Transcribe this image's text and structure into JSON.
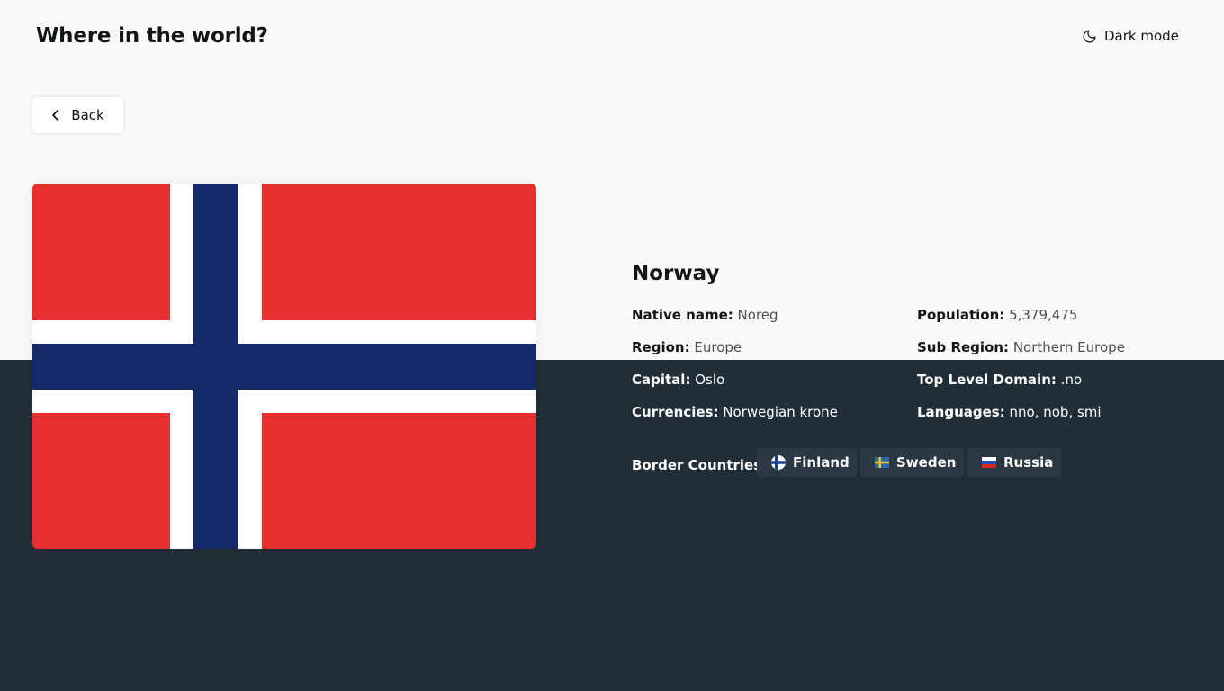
{
  "header": {
    "title": "Where in the world?",
    "dark_mode_label": "Dark mode",
    "dark_mode_icon": "moon-icon"
  },
  "nav": {
    "back_label": "Back",
    "back_icon": "chevron-left-icon"
  },
  "flag": {
    "icon": "norway-flag",
    "red": "#e63030",
    "white": "#ffffff",
    "blue": "#14286a"
  },
  "country": {
    "name": "Norway",
    "native_name_label": "Native name:",
    "native_name": "Noreg",
    "region_label": "Region:",
    "region": "Europe",
    "capital_label": "Capital:",
    "capital": "Oslo",
    "currencies_label": "Currencies:",
    "currencies": "Norwegian krone",
    "population_label": "Population:",
    "population": "5,379,475",
    "subregion_label": "Sub Region:",
    "subregion": "Northern Europe",
    "tld_label": "Top Level Domain:",
    "tld": ".no",
    "languages_label": "Languages:",
    "languages": "nno, nob, smi"
  },
  "borders": {
    "label": "Border Countries:",
    "items": [
      {
        "name": "Finland",
        "icon": "finland-flag-icon"
      },
      {
        "name": "Sweden",
        "icon": "sweden-flag-icon"
      },
      {
        "name": "Russia",
        "icon": "russia-flag-icon"
      }
    ]
  },
  "colors": {
    "light_background": "#fafafa",
    "dark_background": "#212e37",
    "chip_background": "#2b3844",
    "text_dark": "#111517"
  }
}
